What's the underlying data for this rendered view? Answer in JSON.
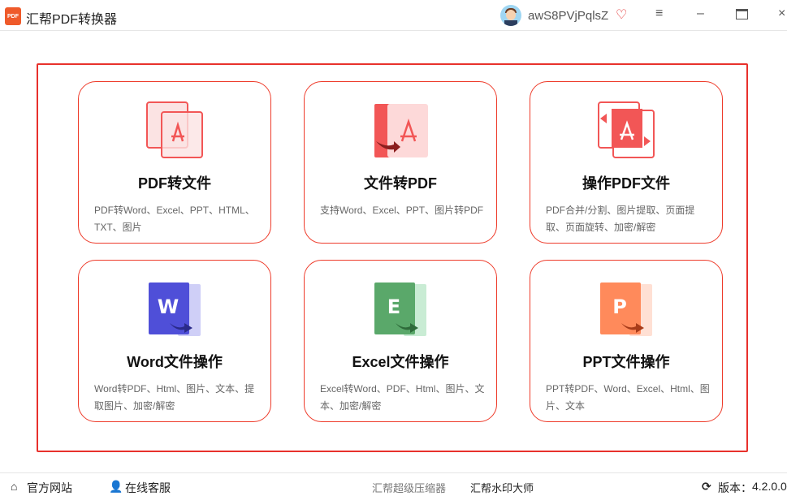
{
  "app": {
    "title": "汇帮PDF转换器",
    "logo_text": "PDF",
    "username": "awS8PVjPqlsZ"
  },
  "window": {
    "menu_icon": "menu-icon",
    "min_icon": "minimize-icon",
    "max_icon": "maximize-icon",
    "close_icon": "close-icon"
  },
  "cards": [
    {
      "title": "PDF转文件",
      "desc": "PDF转Word、Excel、PPT、HTML、TXT、图片",
      "icon": "pdf-to-file-icon"
    },
    {
      "title": "文件转PDF",
      "desc": "支持Word、Excel、PPT、图片转PDF",
      "icon": "file-to-pdf-icon"
    },
    {
      "title": "操作PDF文件",
      "desc": "PDF合并/分割、图片提取、页面提取、页面旋转、加密/解密",
      "icon": "pdf-operate-icon"
    },
    {
      "title": "Word文件操作",
      "desc": "Word转PDF、Html、图片、文本、提取图片、加密/解密",
      "icon": "word-icon",
      "letter": "W"
    },
    {
      "title": "Excel文件操作",
      "desc": "Excel转Word、PDF、Html、图片、文本、加密/解密",
      "icon": "excel-icon",
      "letter": "E"
    },
    {
      "title": "PPT文件操作",
      "desc": "PPT转PDF、Word、Excel、Html、图片、文本",
      "icon": "ppt-icon",
      "letter": "P"
    }
  ],
  "footer": {
    "website": "官方网站",
    "service": "在线客服",
    "compressor": "汇帮超级压缩器",
    "watermark": "汇帮水印大师",
    "version_label": "版本：",
    "version": "4.2.0.0"
  },
  "colors": {
    "accent": "#e8312c",
    "pdf": "#f25656",
    "word": "#4f4fd8",
    "excel": "#5aa86a",
    "ppt": "#ff8a5b"
  }
}
